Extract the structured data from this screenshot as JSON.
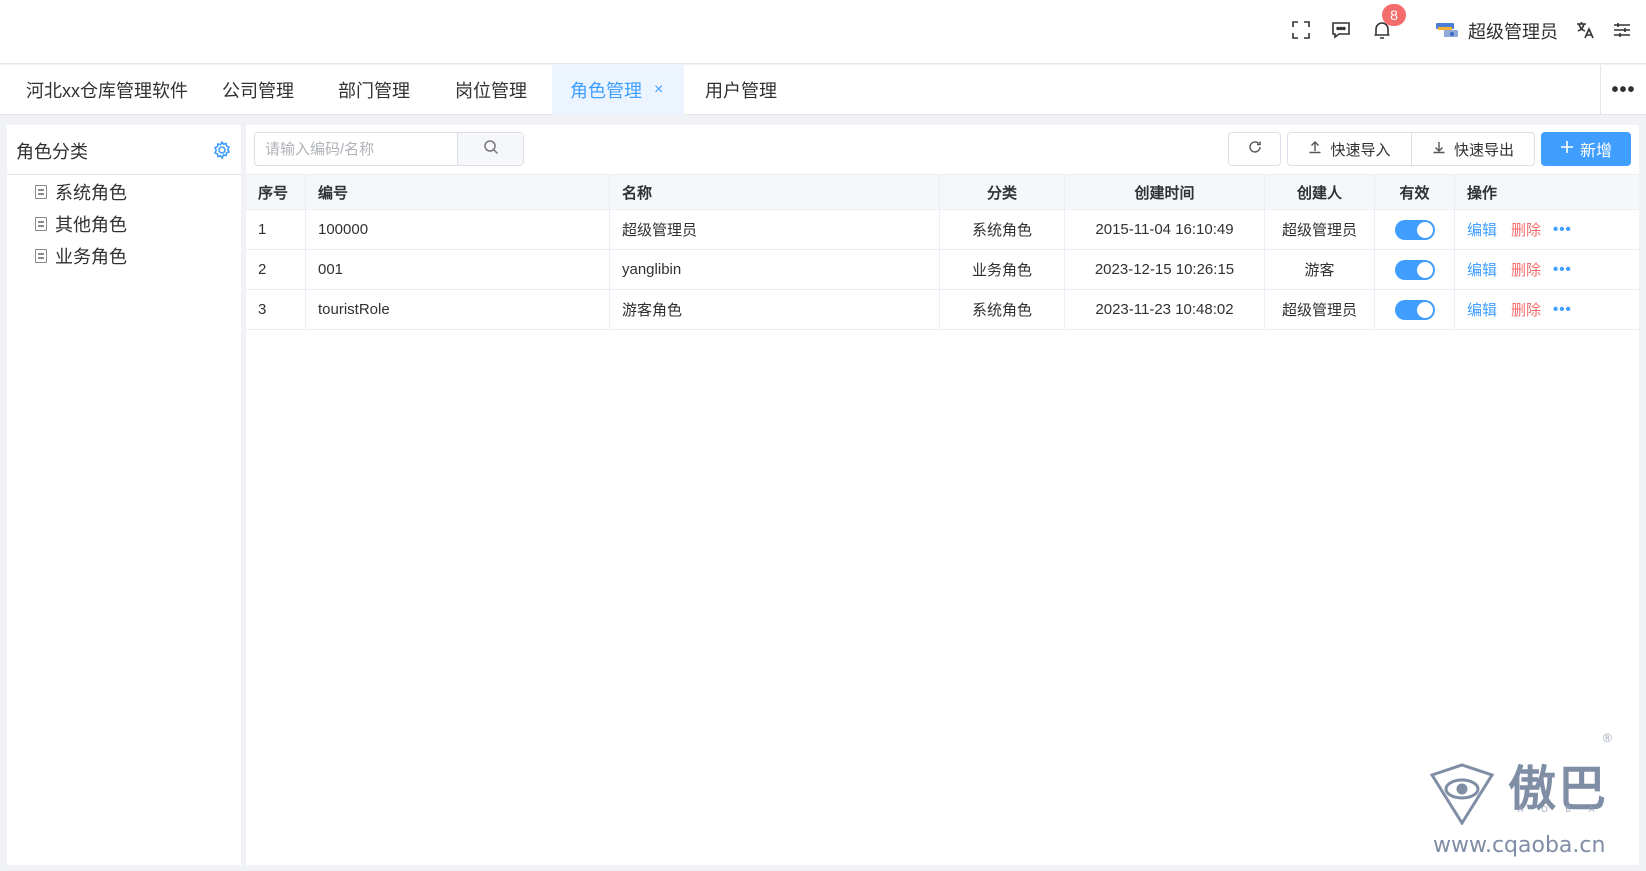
{
  "header": {
    "notification_count": "8",
    "user_name": "超级管理员"
  },
  "tabs": [
    {
      "label": "河北xx仓库管理软件"
    },
    {
      "label": "公司管理"
    },
    {
      "label": "部门管理"
    },
    {
      "label": "岗位管理"
    },
    {
      "label": "角色管理",
      "close": "×"
    },
    {
      "label": "用户管理"
    }
  ],
  "tabs_more": "•••",
  "left": {
    "title": "角色分类",
    "items": [
      {
        "label": "系统角色"
      },
      {
        "label": "其他角色"
      },
      {
        "label": "业务角色"
      }
    ]
  },
  "toolbar": {
    "search_placeholder": "请输入编码/名称",
    "import_label": "快速导入",
    "export_label": "快速导出",
    "new_label": "新增"
  },
  "table": {
    "columns": [
      "序号",
      "编号",
      "名称",
      "分类",
      "创建时间",
      "创建人",
      "有效",
      "操作"
    ],
    "rows": [
      {
        "index": "1",
        "code": "100000",
        "name": "超级管理员",
        "category": "系统角色",
        "created": "2015-11-04 16:10:49",
        "creator": "超级管理员",
        "active": true,
        "edit": "编辑",
        "del": "删除",
        "more": "•••"
      },
      {
        "index": "2",
        "code": "001",
        "name": "yanglibin",
        "category": "业务角色",
        "created": "2023-12-15 10:26:15",
        "creator": "游客",
        "active": true,
        "edit": "编辑",
        "del": "删除",
        "more": "•••"
      },
      {
        "index": "3",
        "code": "touristRole",
        "name": "游客角色",
        "category": "系统角色",
        "created": "2023-11-23 10:48:02",
        "creator": "超级管理员",
        "active": true,
        "edit": "编辑",
        "del": "删除",
        "more": "•••"
      }
    ]
  },
  "watermark": {
    "brand": "傲巴",
    "sub": "AOBA",
    "url": "www.cqaoba.cn",
    "reg": "®"
  },
  "colors": {
    "primary": "#409eff",
    "danger": "#f56c6c"
  },
  "icons": [
    "fullscreen-icon",
    "message-icon",
    "bell-icon",
    "avatar-icon",
    "translate-icon",
    "settings-sliders-icon",
    "gear-icon",
    "document-icon",
    "search-icon",
    "refresh-icon",
    "upload-icon",
    "download-icon",
    "plus-icon"
  ]
}
